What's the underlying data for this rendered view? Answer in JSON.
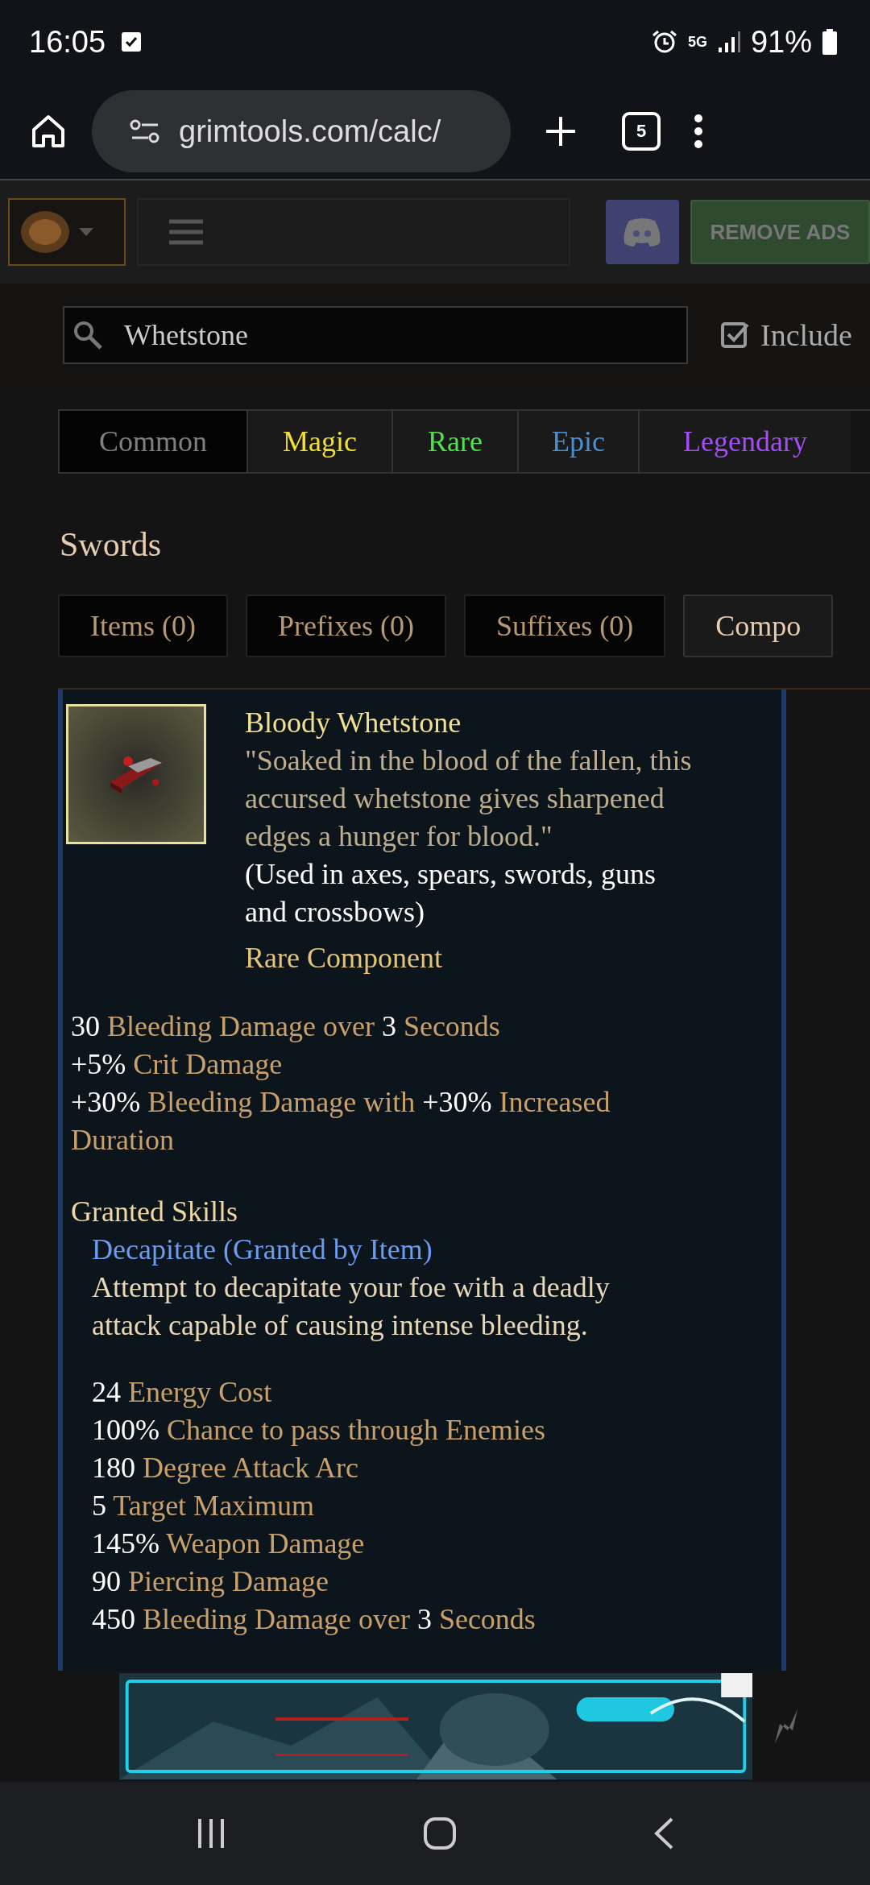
{
  "status_bar": {
    "time": "16:05",
    "network": "5G",
    "battery": "91%"
  },
  "browser": {
    "url": "grimtools.com/calc/",
    "tab_count": "5"
  },
  "site_header": {
    "remove_ads": "REMOVE ADS"
  },
  "search": {
    "value": "Whetstone",
    "include_label": "Include",
    "include_checked": true
  },
  "rarity_tabs": [
    {
      "label": "Common",
      "kind": "common",
      "selected": true
    },
    {
      "label": "Magic",
      "kind": "magic",
      "selected": false
    },
    {
      "label": "Rare",
      "kind": "rare",
      "selected": false
    },
    {
      "label": "Epic",
      "kind": "epic",
      "selected": false
    },
    {
      "label": "Legendary",
      "kind": "legendary",
      "selected": false
    }
  ],
  "section_title": "Swords",
  "category_tabs": [
    {
      "label": "Items (0)",
      "selected": false
    },
    {
      "label": "Prefixes (0)",
      "selected": false
    },
    {
      "label": "Suffixes (0)",
      "selected": false
    },
    {
      "label": "Compo",
      "selected": true
    }
  ],
  "item": {
    "name": "Bloody Whetstone",
    "quote": "\"Soaked in the blood of the fallen, this accursed whetstone gives sharpened edges a hunger for blood.\"",
    "usage": "(Used in axes, spears, swords, guns and crossbows)",
    "type": "Rare Component",
    "stats": [
      [
        {
          "kind": "value",
          "text": "30"
        },
        {
          "kind": "label",
          "text": " Bleeding Damage over "
        },
        {
          "kind": "value",
          "text": "3"
        },
        {
          "kind": "label",
          "text": " Seconds"
        }
      ],
      [
        {
          "kind": "value",
          "text": "+5%"
        },
        {
          "kind": "label",
          "text": " Crit Damage"
        }
      ],
      [
        {
          "kind": "value",
          "text": "+30%"
        },
        {
          "kind": "label",
          "text": " Bleeding Damage with "
        },
        {
          "kind": "value",
          "text": "+30%"
        },
        {
          "kind": "label",
          "text": " Increased Duration"
        }
      ]
    ],
    "granted_title": "Granted Skills",
    "skill": {
      "name": "Decapitate (Granted by Item)",
      "description": "Attempt to decapitate your foe with a deadly attack capable of causing intense bleeding.",
      "stats": [
        [
          {
            "kind": "value",
            "text": "24"
          },
          {
            "kind": "label",
            "text": " Energy Cost"
          }
        ],
        [
          {
            "kind": "value",
            "text": "100%"
          },
          {
            "kind": "label",
            "text": " Chance to pass through Enemies"
          }
        ],
        [
          {
            "kind": "value",
            "text": "180"
          },
          {
            "kind": "label",
            "text": " Degree Attack Arc"
          }
        ],
        [
          {
            "kind": "value",
            "text": "5"
          },
          {
            "kind": "label",
            "text": " Target Maximum"
          }
        ],
        [
          {
            "kind": "value",
            "text": "145%"
          },
          {
            "kind": "label",
            "text": " Weapon Damage"
          }
        ],
        [
          {
            "kind": "value",
            "text": "90"
          },
          {
            "kind": "label",
            "text": " Piercing Damage"
          }
        ],
        [
          {
            "kind": "value",
            "text": "450"
          },
          {
            "kind": "label",
            "text": " Bleeding Damage over "
          },
          {
            "kind": "value",
            "text": "3"
          },
          {
            "kind": "label",
            "text": " Seconds"
          }
        ]
      ]
    }
  }
}
